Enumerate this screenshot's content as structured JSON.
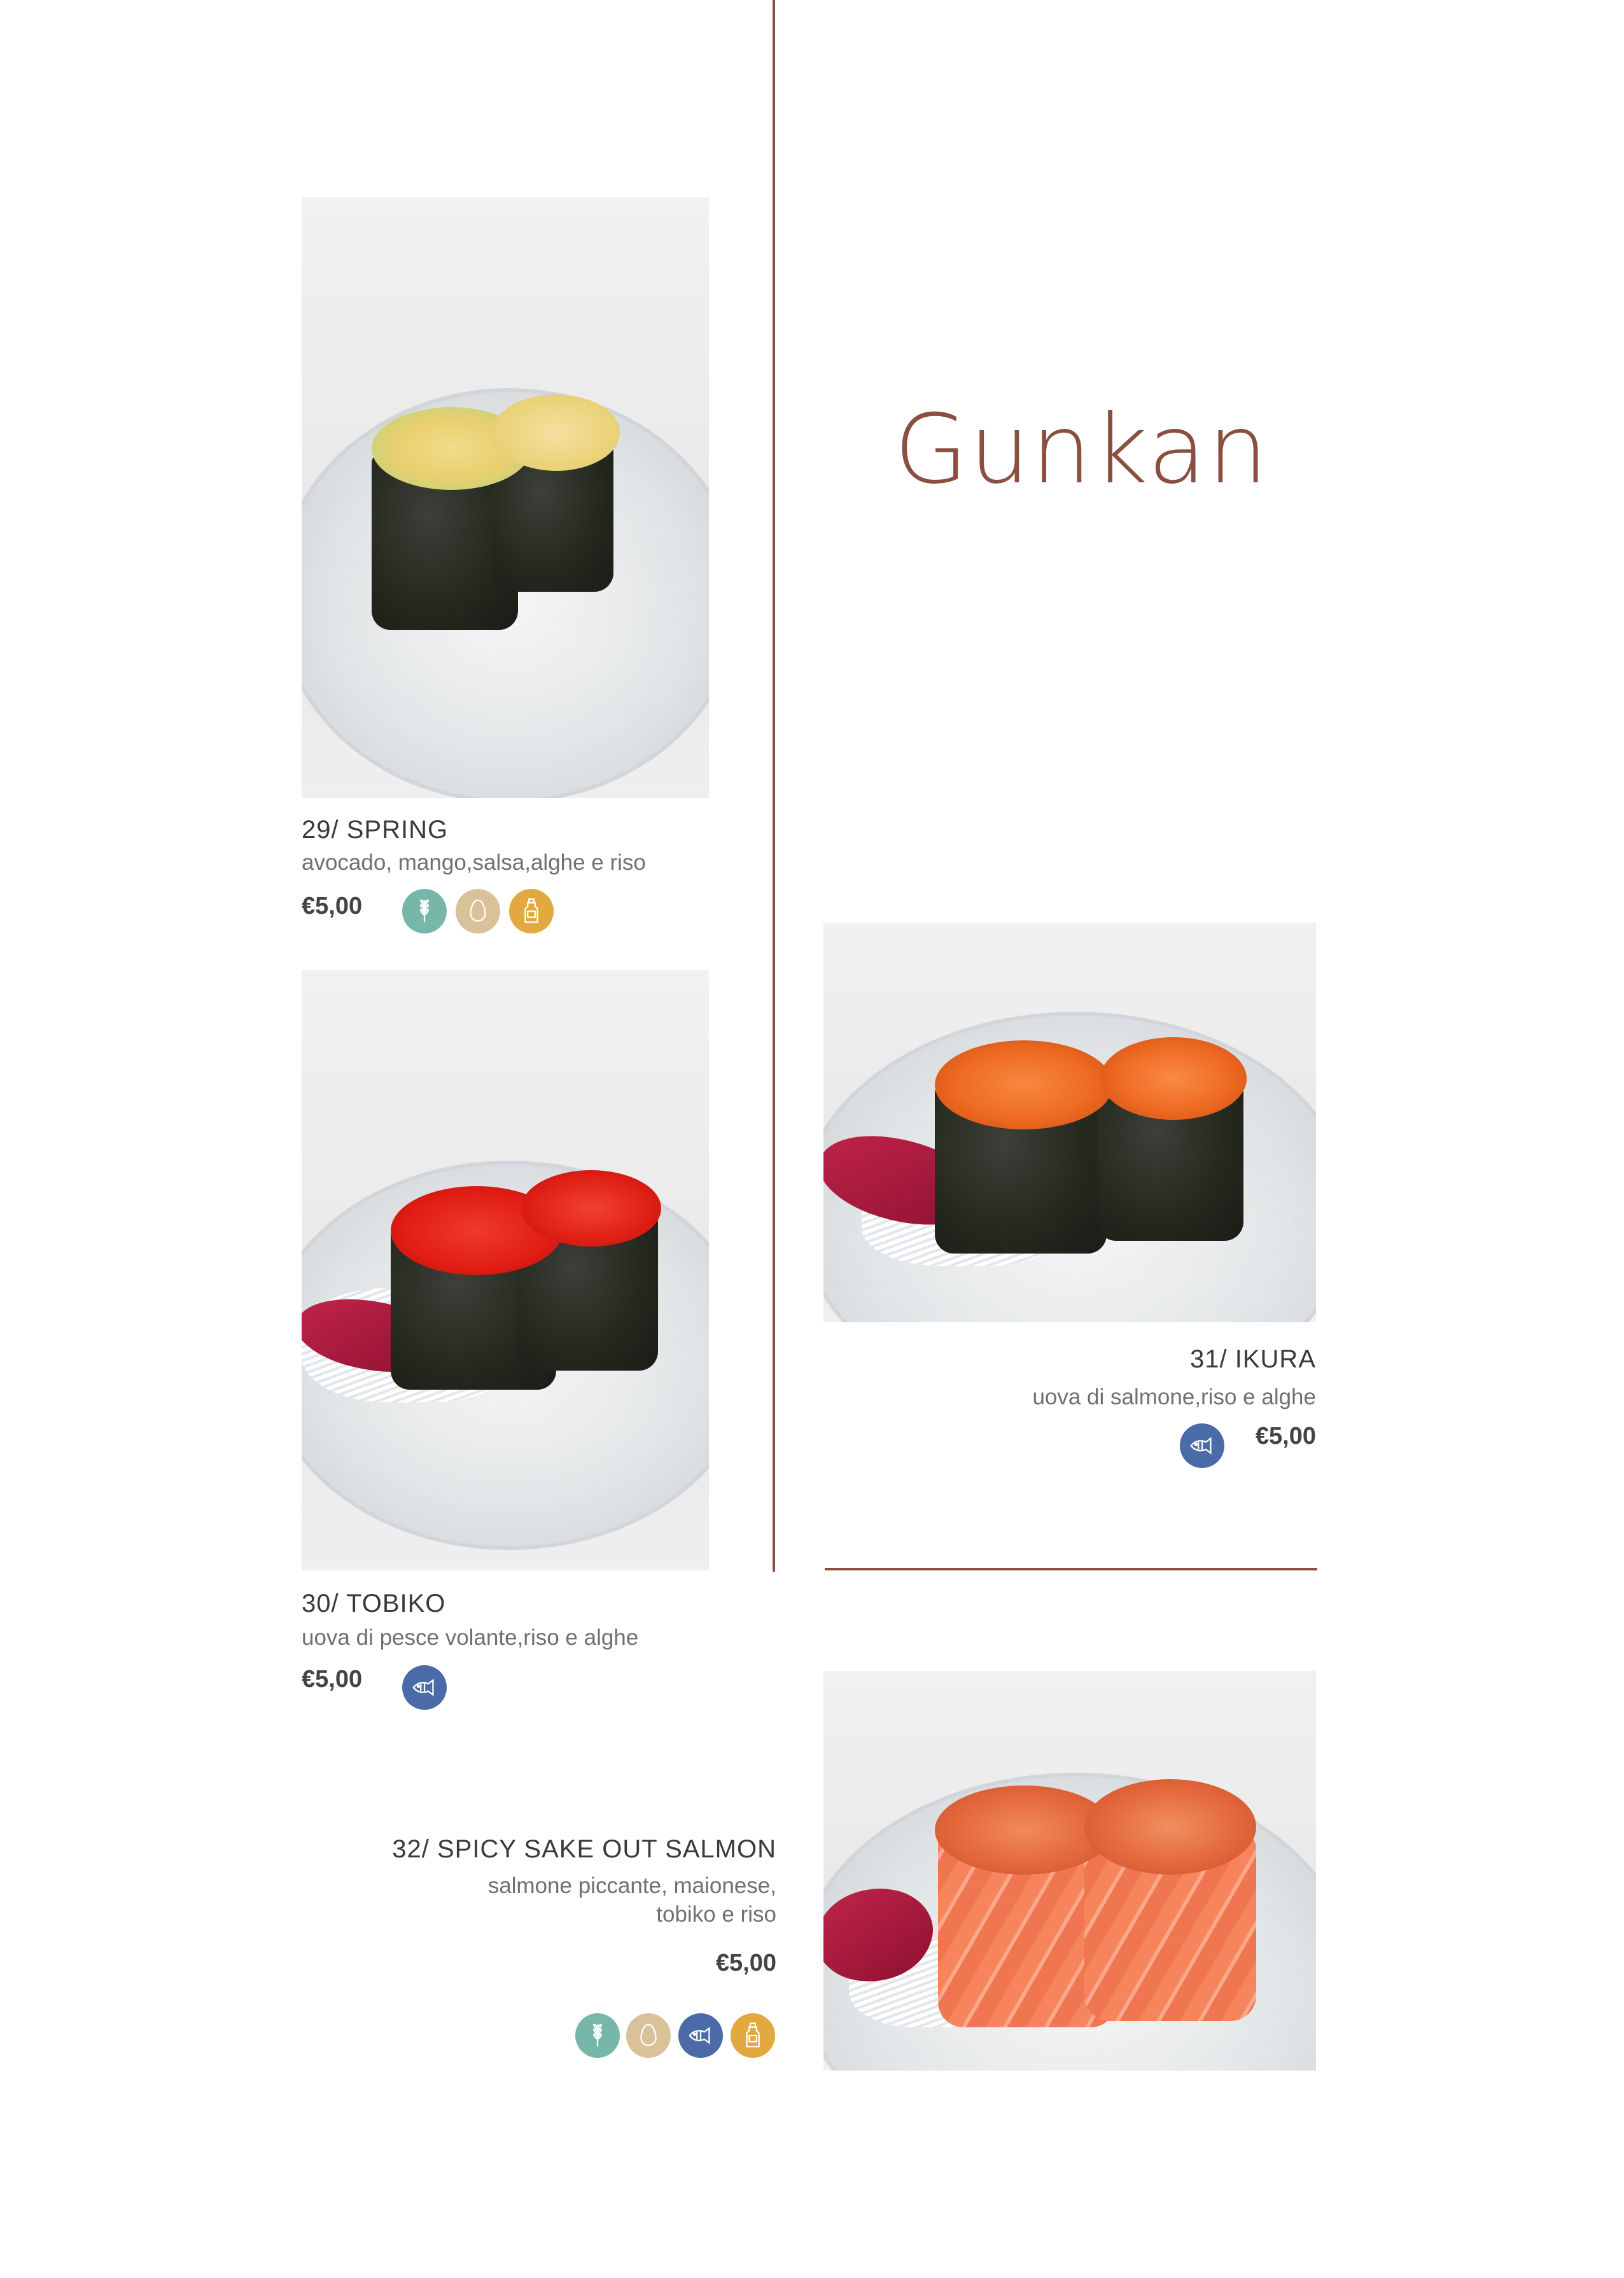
{
  "section_title": "Gunkan",
  "items": [
    {
      "name": "29/ SPRING",
      "description": "avocado, mango,salsa,alghe e riso",
      "price": "€5,00",
      "allergens": [
        "wheat-icon",
        "egg-icon",
        "sauce-bottle-icon"
      ]
    },
    {
      "name": "30/ TOBIKO",
      "description": "uova di pesce volante,riso e alghe",
      "price": "€5,00",
      "allergens": [
        "fish-icon"
      ]
    },
    {
      "name": "31/ IKURA",
      "description": "uova di salmone,riso e alghe",
      "price": "€5,00",
      "allergens": [
        "fish-icon"
      ]
    },
    {
      "name": "32/ SPICY SAKE OUT SALMON",
      "description_line1": "salmone piccante, maionese,",
      "description_line2": "tobiko e riso",
      "price": "€5,00",
      "allergens": [
        "wheat-icon",
        "egg-icon",
        "fish-icon",
        "sauce-bottle-icon"
      ]
    }
  ],
  "colors": {
    "accent": "#8a4f40",
    "gluten": "#76b7a9",
    "egg": "#d9c19a",
    "fish": "#4a6aa8",
    "sauce": "#e1a93f"
  }
}
